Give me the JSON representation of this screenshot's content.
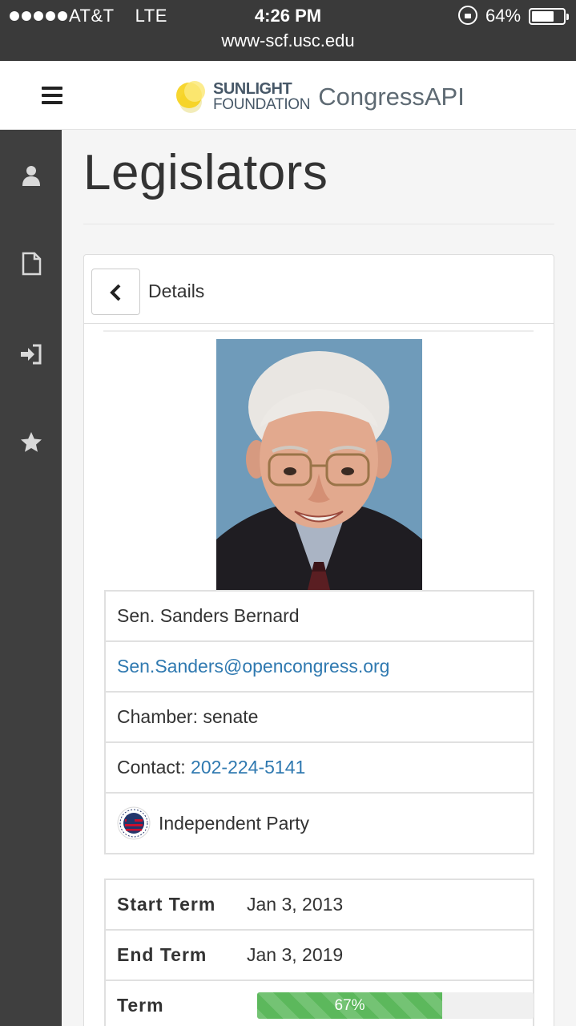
{
  "status_bar": {
    "carrier": "AT&T",
    "network": "LTE",
    "time": "4:26 PM",
    "battery": "64%",
    "url": "www-scf.usc.edu"
  },
  "nav": {
    "brand_line1": "SUNLIGHT",
    "brand_line2": "FOUNDATION",
    "product": "CongressAPI"
  },
  "sidebar": {
    "icons": [
      "user-icon",
      "document-icon",
      "sign-in-icon",
      "star-icon"
    ]
  },
  "page": {
    "title": "Legislators"
  },
  "panel": {
    "title": "Details",
    "name": "Sen. Sanders Bernard",
    "email": "Sen.Sanders@opencongress.org",
    "chamber_label": "Chamber:",
    "chamber": "senate",
    "contact_label": "Contact:",
    "contact_phone": "202-224-5141",
    "party": "Independent Party",
    "party_logo_text": "INDEPENDENT AMERICAN PARTY"
  },
  "term": {
    "start_label": "Start Term",
    "start": "Jan 3, 2013",
    "end_label": "End Term",
    "end": "Jan 3, 2019",
    "term_label": "Term",
    "progress_text": "67%",
    "progress_value": 0.67
  },
  "colors": {
    "sidebar": "#3f3f3f",
    "link": "#2f79b0",
    "progress": "#5cb85c"
  }
}
